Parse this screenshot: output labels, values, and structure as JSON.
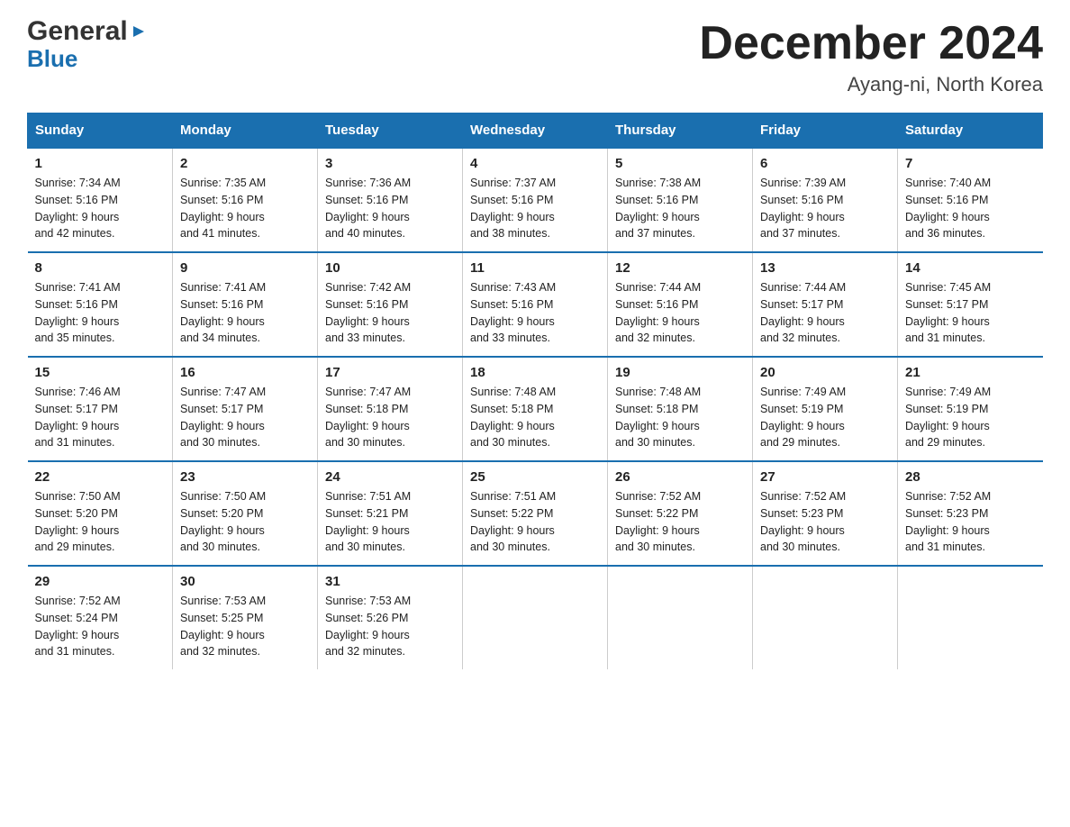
{
  "logo": {
    "general": "General",
    "arrow": "▶",
    "blue": "Blue"
  },
  "title": "December 2024",
  "subtitle": "Ayang-ni, North Korea",
  "days_of_week": [
    "Sunday",
    "Monday",
    "Tuesday",
    "Wednesday",
    "Thursday",
    "Friday",
    "Saturday"
  ],
  "weeks": [
    [
      {
        "day": "1",
        "sunrise": "7:34 AM",
        "sunset": "5:16 PM",
        "daylight": "9 hours and 42 minutes."
      },
      {
        "day": "2",
        "sunrise": "7:35 AM",
        "sunset": "5:16 PM",
        "daylight": "9 hours and 41 minutes."
      },
      {
        "day": "3",
        "sunrise": "7:36 AM",
        "sunset": "5:16 PM",
        "daylight": "9 hours and 40 minutes."
      },
      {
        "day": "4",
        "sunrise": "7:37 AM",
        "sunset": "5:16 PM",
        "daylight": "9 hours and 38 minutes."
      },
      {
        "day": "5",
        "sunrise": "7:38 AM",
        "sunset": "5:16 PM",
        "daylight": "9 hours and 37 minutes."
      },
      {
        "day": "6",
        "sunrise": "7:39 AM",
        "sunset": "5:16 PM",
        "daylight": "9 hours and 37 minutes."
      },
      {
        "day": "7",
        "sunrise": "7:40 AM",
        "sunset": "5:16 PM",
        "daylight": "9 hours and 36 minutes."
      }
    ],
    [
      {
        "day": "8",
        "sunrise": "7:41 AM",
        "sunset": "5:16 PM",
        "daylight": "9 hours and 35 minutes."
      },
      {
        "day": "9",
        "sunrise": "7:41 AM",
        "sunset": "5:16 PM",
        "daylight": "9 hours and 34 minutes."
      },
      {
        "day": "10",
        "sunrise": "7:42 AM",
        "sunset": "5:16 PM",
        "daylight": "9 hours and 33 minutes."
      },
      {
        "day": "11",
        "sunrise": "7:43 AM",
        "sunset": "5:16 PM",
        "daylight": "9 hours and 33 minutes."
      },
      {
        "day": "12",
        "sunrise": "7:44 AM",
        "sunset": "5:16 PM",
        "daylight": "9 hours and 32 minutes."
      },
      {
        "day": "13",
        "sunrise": "7:44 AM",
        "sunset": "5:17 PM",
        "daylight": "9 hours and 32 minutes."
      },
      {
        "day": "14",
        "sunrise": "7:45 AM",
        "sunset": "5:17 PM",
        "daylight": "9 hours and 31 minutes."
      }
    ],
    [
      {
        "day": "15",
        "sunrise": "7:46 AM",
        "sunset": "5:17 PM",
        "daylight": "9 hours and 31 minutes."
      },
      {
        "day": "16",
        "sunrise": "7:47 AM",
        "sunset": "5:17 PM",
        "daylight": "9 hours and 30 minutes."
      },
      {
        "day": "17",
        "sunrise": "7:47 AM",
        "sunset": "5:18 PM",
        "daylight": "9 hours and 30 minutes."
      },
      {
        "day": "18",
        "sunrise": "7:48 AM",
        "sunset": "5:18 PM",
        "daylight": "9 hours and 30 minutes."
      },
      {
        "day": "19",
        "sunrise": "7:48 AM",
        "sunset": "5:18 PM",
        "daylight": "9 hours and 30 minutes."
      },
      {
        "day": "20",
        "sunrise": "7:49 AM",
        "sunset": "5:19 PM",
        "daylight": "9 hours and 29 minutes."
      },
      {
        "day": "21",
        "sunrise": "7:49 AM",
        "sunset": "5:19 PM",
        "daylight": "9 hours and 29 minutes."
      }
    ],
    [
      {
        "day": "22",
        "sunrise": "7:50 AM",
        "sunset": "5:20 PM",
        "daylight": "9 hours and 29 minutes."
      },
      {
        "day": "23",
        "sunrise": "7:50 AM",
        "sunset": "5:20 PM",
        "daylight": "9 hours and 30 minutes."
      },
      {
        "day": "24",
        "sunrise": "7:51 AM",
        "sunset": "5:21 PM",
        "daylight": "9 hours and 30 minutes."
      },
      {
        "day": "25",
        "sunrise": "7:51 AM",
        "sunset": "5:22 PM",
        "daylight": "9 hours and 30 minutes."
      },
      {
        "day": "26",
        "sunrise": "7:52 AM",
        "sunset": "5:22 PM",
        "daylight": "9 hours and 30 minutes."
      },
      {
        "day": "27",
        "sunrise": "7:52 AM",
        "sunset": "5:23 PM",
        "daylight": "9 hours and 30 minutes."
      },
      {
        "day": "28",
        "sunrise": "7:52 AM",
        "sunset": "5:23 PM",
        "daylight": "9 hours and 31 minutes."
      }
    ],
    [
      {
        "day": "29",
        "sunrise": "7:52 AM",
        "sunset": "5:24 PM",
        "daylight": "9 hours and 31 minutes."
      },
      {
        "day": "30",
        "sunrise": "7:53 AM",
        "sunset": "5:25 PM",
        "daylight": "9 hours and 32 minutes."
      },
      {
        "day": "31",
        "sunrise": "7:53 AM",
        "sunset": "5:26 PM",
        "daylight": "9 hours and 32 minutes."
      },
      null,
      null,
      null,
      null
    ]
  ],
  "labels": {
    "sunrise": "Sunrise:",
    "sunset": "Sunset:",
    "daylight": "Daylight:"
  }
}
